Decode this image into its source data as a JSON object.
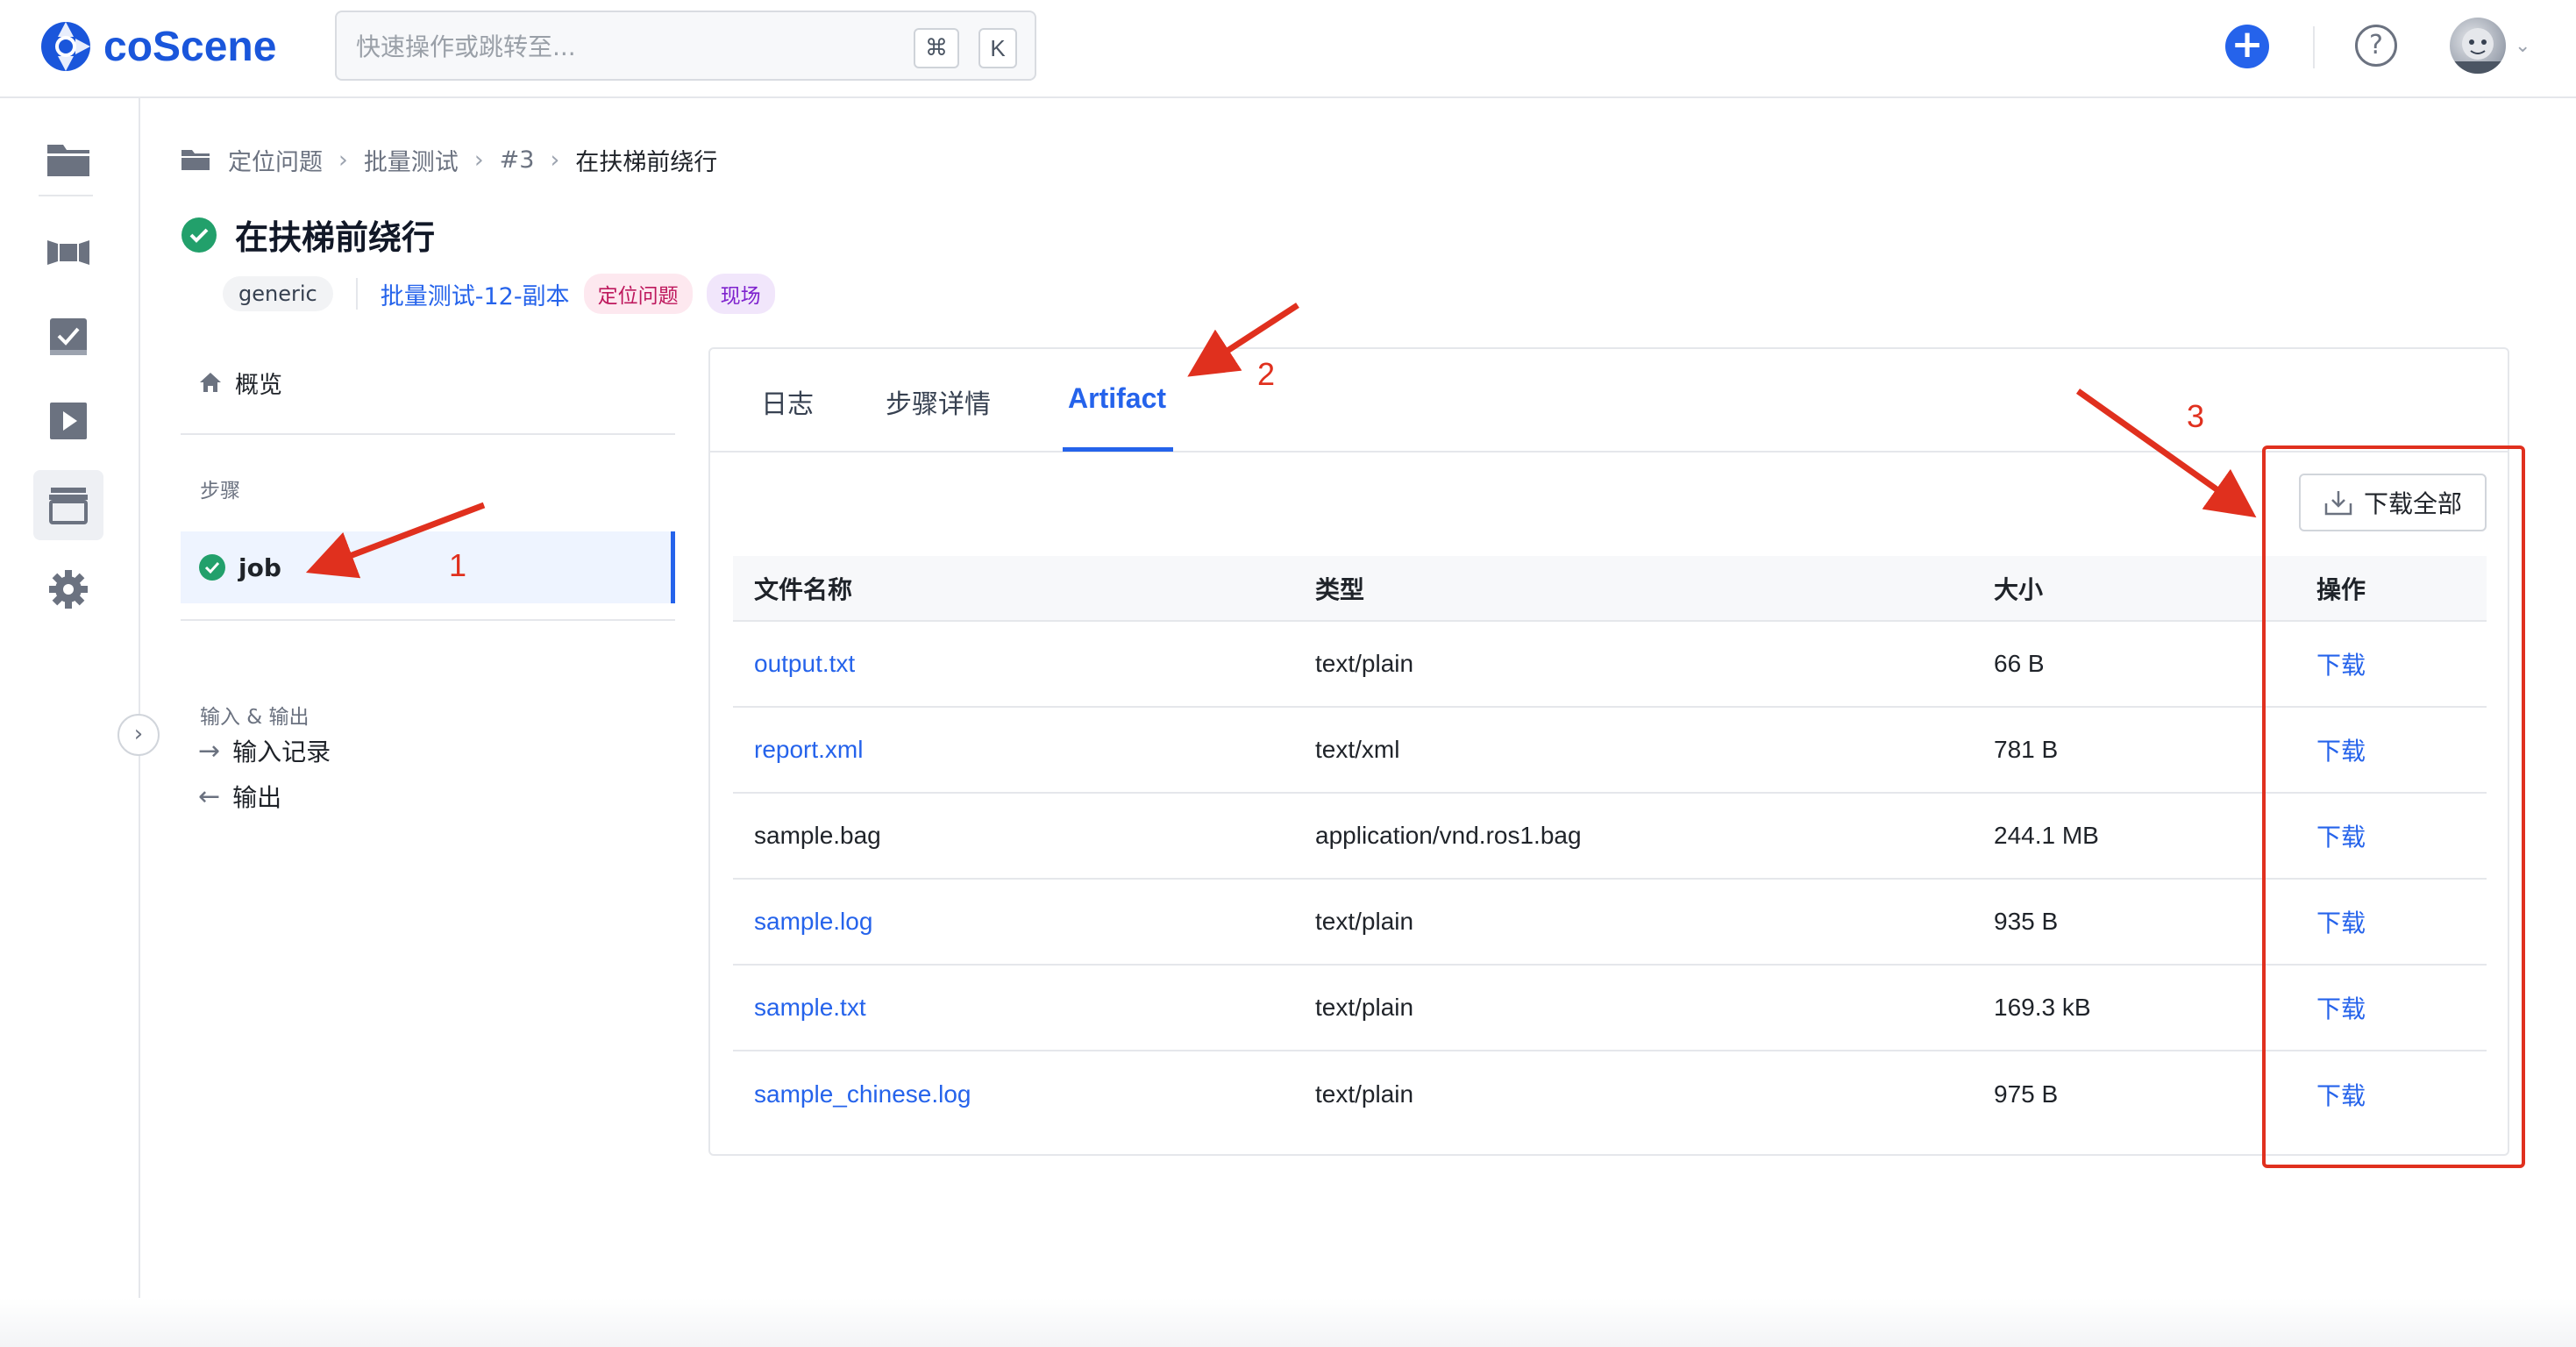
{
  "app": {
    "name": "coScene",
    "brand_color": "#1a56db",
    "accent_color": "#2563eb"
  },
  "search": {
    "placeholder": "快速操作或跳转至...",
    "shortcut_cmd": "⌘",
    "shortcut_key": "K"
  },
  "header": {
    "add_icon": "plus-circle-icon",
    "help_icon": "help-circle-icon",
    "avatar": "user-avatar"
  },
  "nav": [
    "folder-icon",
    "cinema-icon",
    "checklist-icon",
    "play-icon",
    "archive-icon",
    "gear-icon"
  ],
  "breadcrumb": {
    "items": [
      "定位问题",
      "批量测试",
      "#3"
    ],
    "current": "在扶梯前绕行"
  },
  "page": {
    "title": "在扶梯前绕行",
    "status": "success",
    "tags": {
      "type": "generic",
      "link": "批量测试-12-副本",
      "label1": "定位问题",
      "label2": "现场"
    }
  },
  "steps": {
    "overview": "概览",
    "section_steps": "步骤",
    "job": "job",
    "section_io": "输入 & 输出",
    "input_records": "输入记录",
    "output": "输出"
  },
  "tabs": {
    "log": "日志",
    "step_details": "步骤详情",
    "artifact": "Artifact",
    "active": "Artifact"
  },
  "artifact": {
    "download_all": "下载全部",
    "columns": {
      "name": "文件名称",
      "type": "类型",
      "size": "大小",
      "action": "操作"
    },
    "files": [
      {
        "name": "output.txt",
        "type": "text/plain",
        "size": "66 B",
        "action": "下载"
      },
      {
        "name": "report.xml",
        "type": "text/xml",
        "size": "781 B",
        "action": "下载"
      },
      {
        "name": "sample.bag",
        "type": "application/vnd.ros1.bag",
        "size": "244.1 MB",
        "action": "下载"
      },
      {
        "name": "sample.log",
        "type": "text/plain",
        "size": "935 B",
        "action": "下载"
      },
      {
        "name": "sample.txt",
        "type": "text/plain",
        "size": "169.3 kB",
        "action": "下载"
      },
      {
        "name": "sample_chinese.log",
        "type": "text/plain",
        "size": "975 B",
        "action": "下载"
      }
    ]
  },
  "annotations": {
    "n1": "1",
    "n2": "2",
    "n3": "3",
    "color": "#e0301e"
  }
}
